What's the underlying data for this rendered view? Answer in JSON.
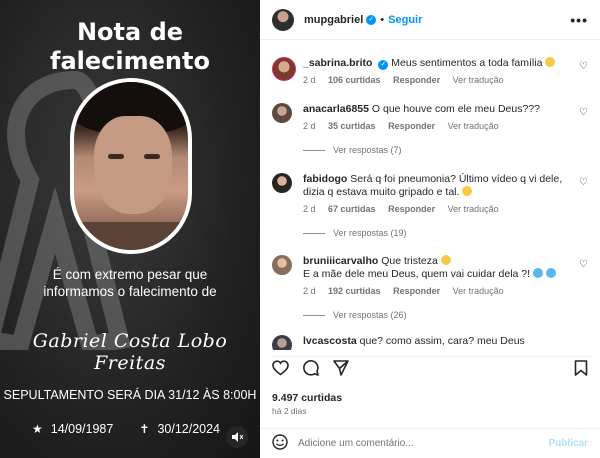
{
  "post": {
    "title_line1": "Nota de",
    "title_line2": "falecimento",
    "text_line1": "É com extremo pesar que",
    "text_line2": "informamos o falecimento de",
    "name_signature": "Gabriel Costa Lobo Freitas",
    "burial": "SEPULTAMENTO SERÁ DIA 31/12 ÀS 8:00H",
    "birth_symbol": "★",
    "birth_date": "14/09/1987",
    "death_symbol": "✝",
    "death_date": "30/12/2024"
  },
  "header": {
    "username": "mupgabriel",
    "separator": "•",
    "follow_label": "Seguir",
    "more_label": "•••"
  },
  "comments": [
    {
      "username": "_sabrina.brito",
      "verified": true,
      "text": "Meus sentimentos a toda família",
      "time": "2 d",
      "likes": "106 curtidas",
      "reply_label": "Responder",
      "translate_label": "Ver tradução"
    },
    {
      "username": "anacarla6855",
      "text": "O que houve com ele meu Deus???",
      "time": "2 d",
      "likes": "35 curtidas",
      "reply_label": "Responder",
      "translate_label": "Ver tradução",
      "view_replies": "Ver respostas (7)"
    },
    {
      "username": "fabidogo",
      "text": "Será q foi pneumonia? Último vídeo q vi dele, dizia q estava muito gripado e tal.",
      "time": "2 d",
      "likes": "67 curtidas",
      "reply_label": "Responder",
      "translate_label": "Ver tradução",
      "view_replies": "Ver respostas (19)"
    },
    {
      "username": "bruniiicarvalho",
      "text": "Que tristeza",
      "text2": "E a mãe dele meu Deus, quem vai cuidar dela ?!",
      "time": "2 d",
      "likes": "192 curtidas",
      "reply_label": "Responder",
      "translate_label": "Ver tradução",
      "view_replies": "Ver respostas (26)"
    },
    {
      "username": "lvcascosta",
      "text": "que? como assim, cara? meu Deus"
    }
  ],
  "likes_total": "9.497 curtidas",
  "posted_ago": "há 2 dias",
  "composer": {
    "placeholder": "Adicione um comentário...",
    "publish_label": "Publicar"
  },
  "icons": {
    "like": "heart-icon",
    "comment": "comment-icon",
    "share": "share-icon",
    "save": "bookmark-icon",
    "emoji": "smile-icon",
    "mute": "speaker-icon"
  },
  "colors": {
    "accent": "#0095f6",
    "publish_disabled": "#b2dffc",
    "muted_text": "#737373"
  }
}
